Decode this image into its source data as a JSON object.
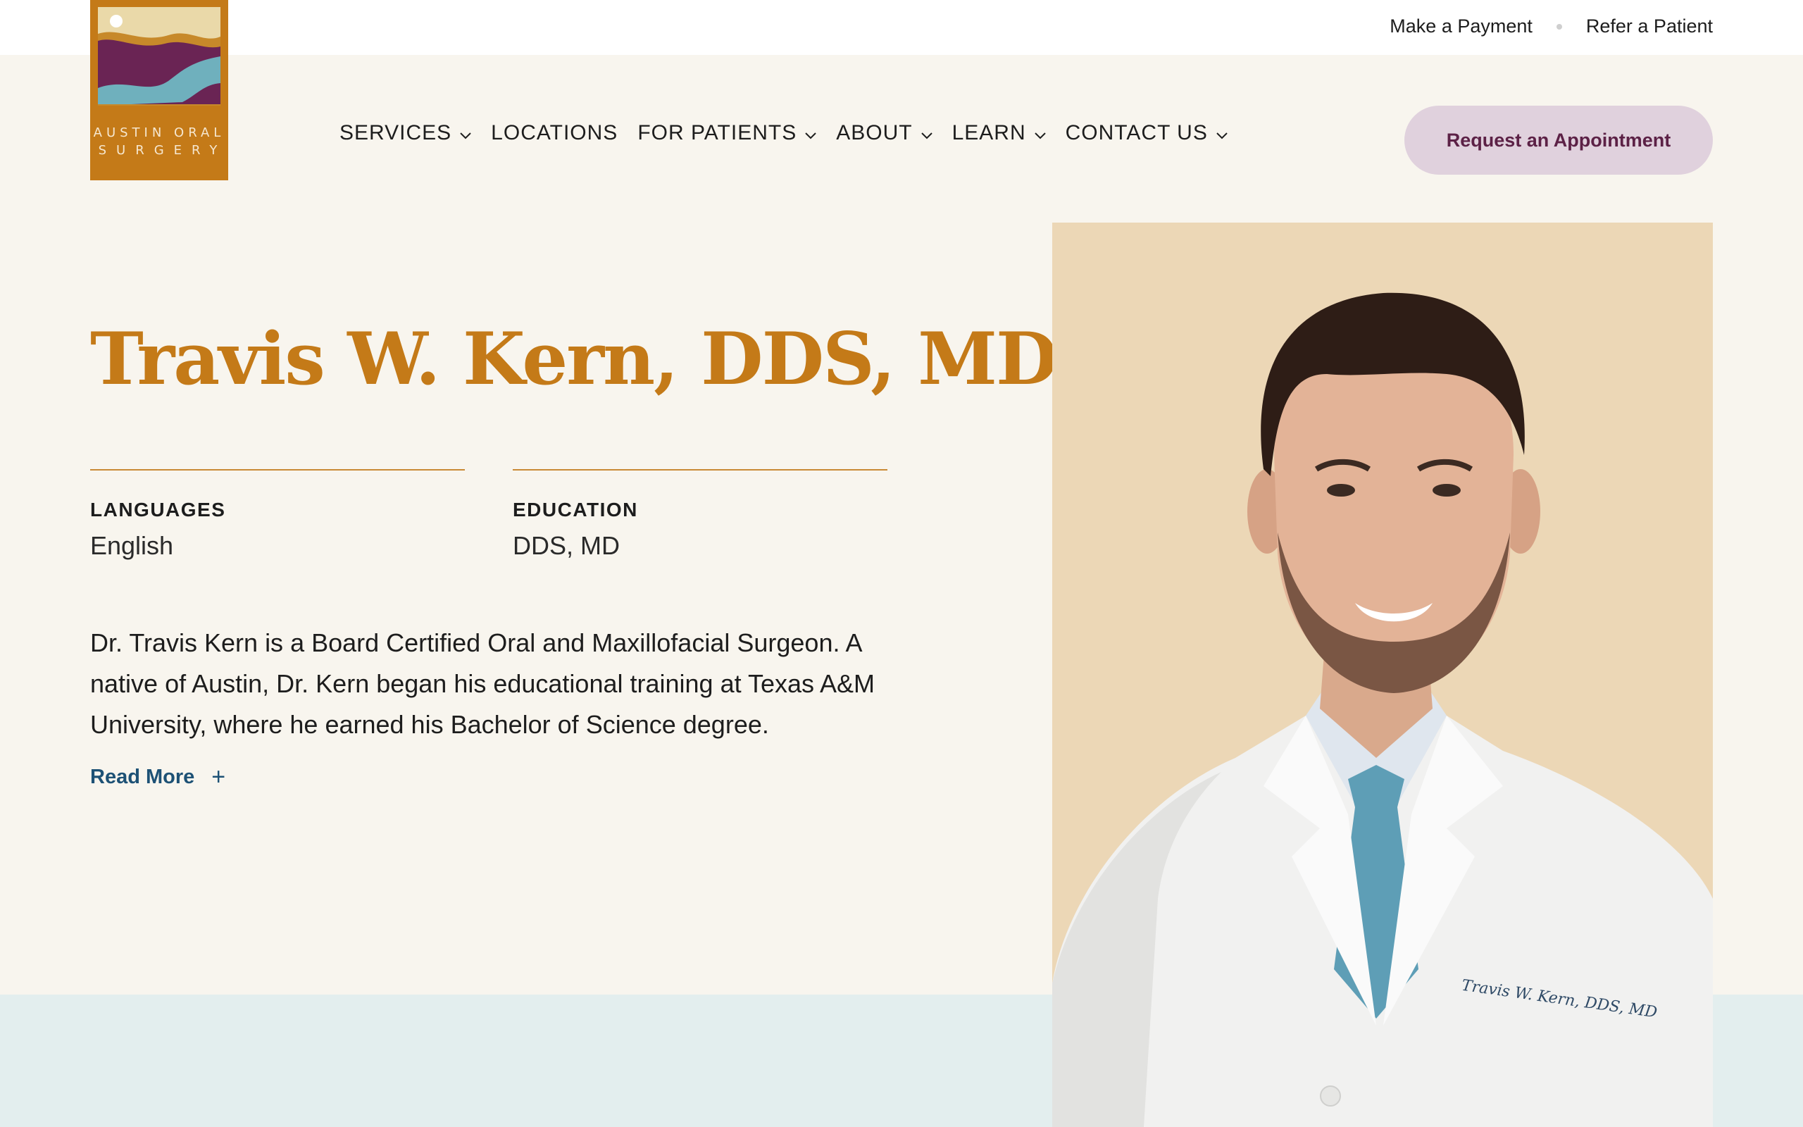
{
  "utility": {
    "payment": "Make a Payment",
    "refer": "Refer a Patient"
  },
  "logo": {
    "line1": "AUSTIN ORAL",
    "line2": "SURGERY"
  },
  "nav": {
    "services": "SERVICES",
    "locations": "LOCATIONS",
    "for_patients": "FOR PATIENTS",
    "about": "ABOUT",
    "learn": "LEARN",
    "contact": "CONTACT US"
  },
  "cta": "Request an Appointment",
  "doctor": {
    "name": "Travis W. Kern, DDS, MD",
    "languages_label": "LANGUAGES",
    "languages_value": "English",
    "education_label": "EDUCATION",
    "education_value": "DDS, MD",
    "bio": "Dr. Travis Kern is a Board Certified Oral and Maxillofacial Surgeon. A native of Austin, Dr. Kern began his educational training at Texas A&M University, where he earned his Bachelor of Science degree.",
    "read_more": "Read More",
    "coat_embroidery": "Travis W. Kern, DDS, MD"
  },
  "colors": {
    "brand_gold": "#c47a18",
    "brand_plum": "#5c2146",
    "cta_bg": "#e0d1dd",
    "link_blue": "#1d5175",
    "page_bg": "#f8f5ee",
    "band_bg": "#e3eeee",
    "portrait_bg": "#ecd7b6"
  }
}
